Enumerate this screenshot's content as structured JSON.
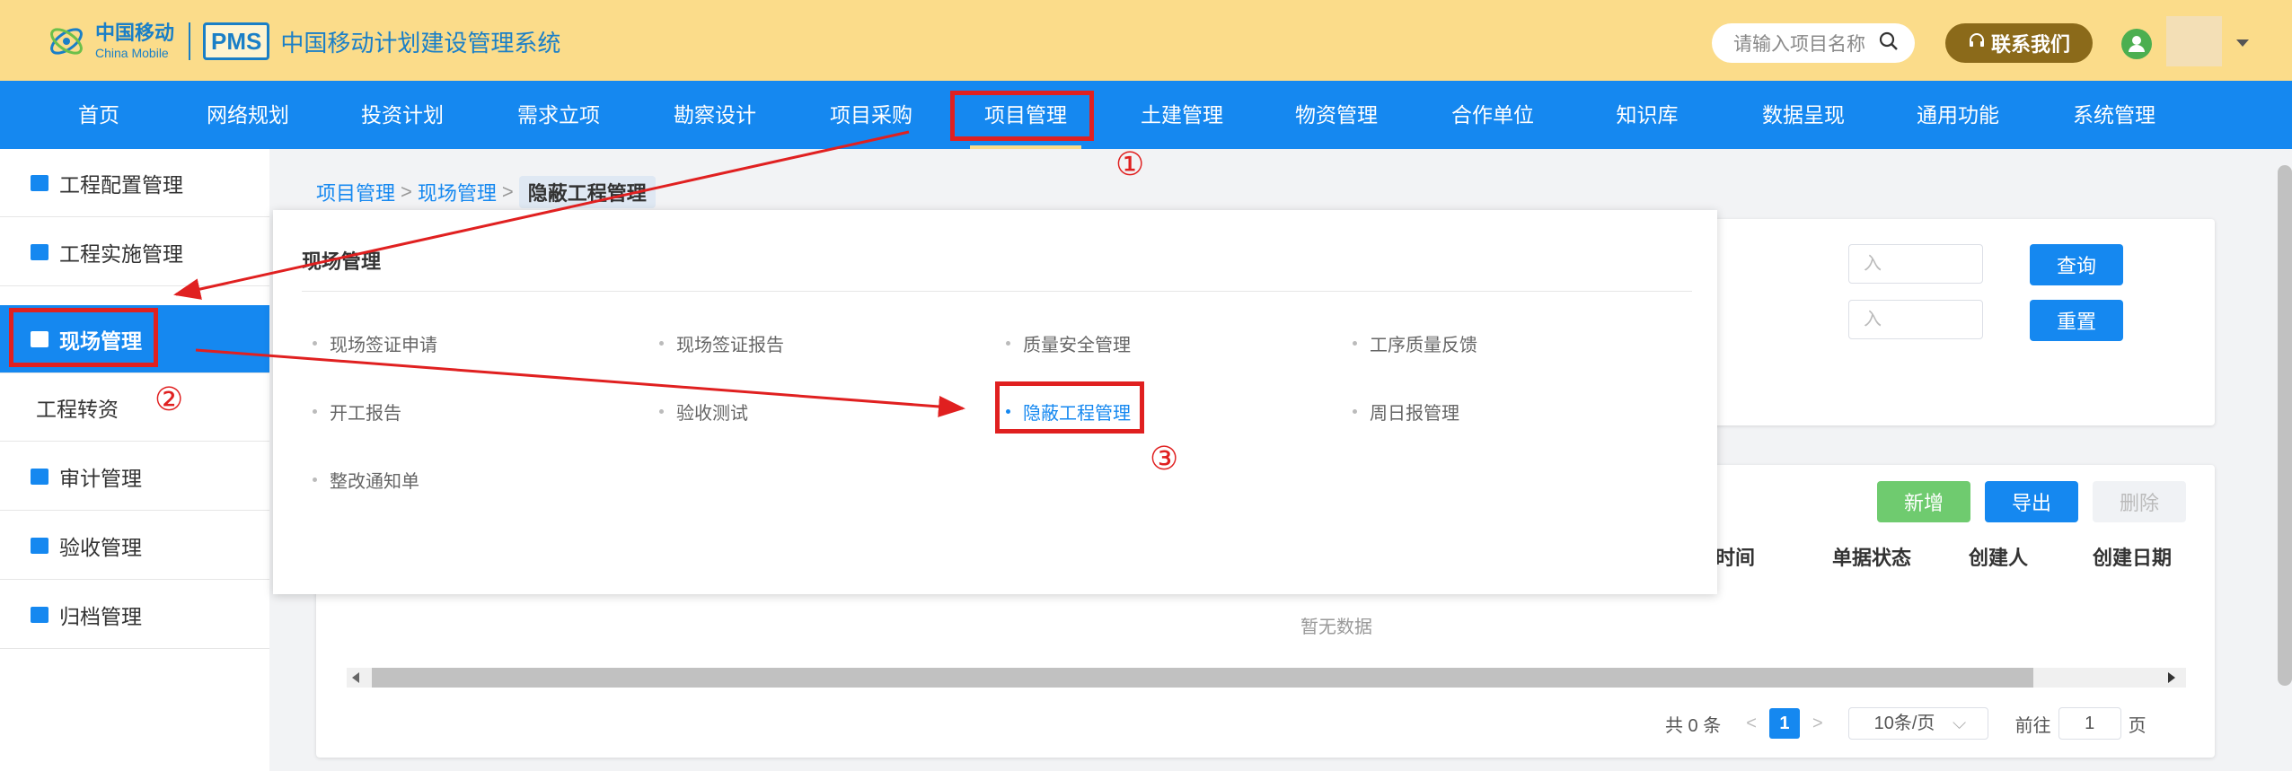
{
  "header": {
    "logo_cn": "中国移动",
    "logo_en": "China Mobile",
    "pms": "PMS",
    "system_title": "中国移动计划建设管理系统",
    "search_placeholder": "请输入项目名称",
    "contact_label": "联系我们"
  },
  "nav": {
    "items": [
      "首页",
      "网络规划",
      "投资计划",
      "需求立项",
      "勘察设计",
      "项目采购",
      "项目管理",
      "土建管理",
      "物资管理",
      "合作单位",
      "知识库",
      "数据呈现",
      "通用功能",
      "系统管理"
    ],
    "active_index": 6
  },
  "sidebar": {
    "items": [
      {
        "label": "工程配置管理",
        "icon": "gear-doc-icon"
      },
      {
        "label": "工程实施管理",
        "icon": "tools-icon"
      },
      {
        "label": "现场管理",
        "icon": "camera-icon",
        "active": true
      },
      {
        "label": "工程转资",
        "icon": ""
      },
      {
        "label": "审计管理",
        "icon": "grid-icon"
      },
      {
        "label": "验收管理",
        "icon": "flag-icon"
      },
      {
        "label": "归档管理",
        "icon": "file-icon"
      }
    ]
  },
  "breadcrumb": [
    "项目管理",
    "现场管理",
    "隐蔽工程管理"
  ],
  "filter": {
    "field1_placeholder": "入",
    "field2_placeholder": "入",
    "query_button": "查询",
    "reset_button": "重置"
  },
  "toolbar": {
    "add_button": "新增",
    "export_button": "导出",
    "delete_button": "删除"
  },
  "table": {
    "headers": [
      "建时间",
      "单据状态",
      "创建人",
      "创建日期"
    ],
    "empty_text": "暂无数据"
  },
  "pagination": {
    "total_text": "共 0 条",
    "current_page": "1",
    "page_size": "10条/页",
    "goto_label": "前往",
    "goto_value": "1",
    "page_suffix": "页"
  },
  "dropdown": {
    "title": "现场管理",
    "items": [
      "现场签证申请",
      "现场签证报告",
      "质量安全管理",
      "工序质量反馈",
      "开工报告",
      "验收测试",
      "隐蔽工程管理",
      "周日报管理",
      "整改通知单"
    ],
    "active_index": 6
  },
  "annotations": {
    "step1": "①",
    "step2": "②",
    "step3": "③",
    "color": "#e02020"
  },
  "colors": {
    "header_bg": "#fbdc8a",
    "nav_bg": "#1588f0",
    "accent": "#1588f0",
    "contact_bg": "#8b6a1a",
    "add_green": "#6fcb6f"
  }
}
